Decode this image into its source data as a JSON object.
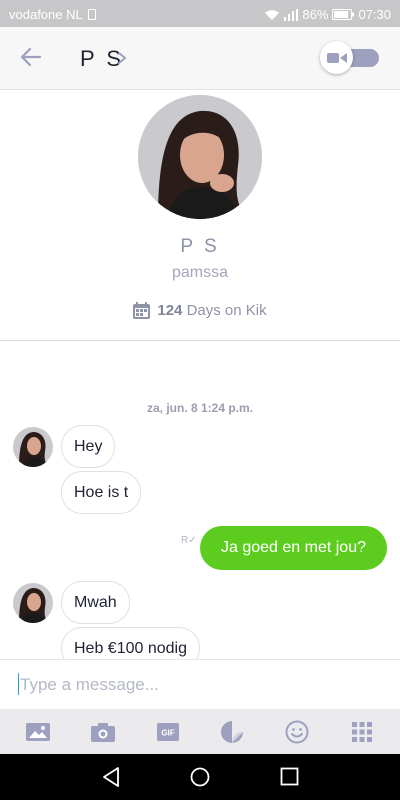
{
  "status_bar": {
    "carrier": "vodafone NL",
    "battery": "86%",
    "time": "07:30"
  },
  "header": {
    "title": "P S"
  },
  "profile": {
    "display_name": "P S",
    "username": "pamssa",
    "days_count": "124",
    "days_label": "Days on Kik"
  },
  "chat": {
    "date_stamp": "za, jun. 8 1:24 p.m.",
    "incoming_1": [
      "Hey",
      "Hoe is t"
    ],
    "outgoing": {
      "text": "Ja goed en met jou?",
      "read_receipt": "R"
    },
    "incoming_2": [
      "Mwah",
      "Heb €100 nodig"
    ]
  },
  "composer": {
    "placeholder": "Type a message..."
  },
  "toolbar": {
    "gif_label": "GIF"
  },
  "colors": {
    "accent_green": "#5ccd1e",
    "header_bg": "#f7f7f8",
    "toolbar_bg": "#ebebee",
    "icon_gray": "#9ea0bf"
  }
}
